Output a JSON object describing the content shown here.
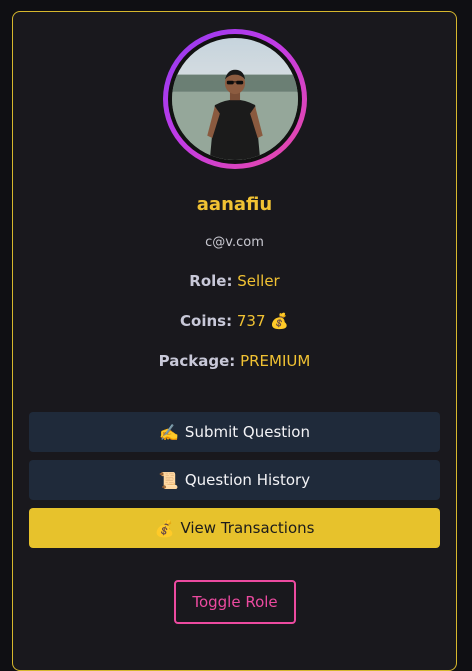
{
  "profile": {
    "username": "aanafiu",
    "email": "c@v.com",
    "role_label": "Role:",
    "role_value": "Seller",
    "coins_label": "Coins:",
    "coins_value": "737",
    "coins_emoji": "💰",
    "package_label": "Package:",
    "package_value": "PREMIUM"
  },
  "actions": {
    "submit": {
      "emoji": "✍️",
      "label": "Submit Question"
    },
    "history": {
      "emoji": "📜",
      "label": "Question History"
    },
    "transactions": {
      "emoji": "💰",
      "label": "View Transactions"
    },
    "toggle_role": "Toggle Role"
  },
  "colors": {
    "accent_yellow": "#f1c233",
    "button_dark": "#1f2a3a",
    "button_yellow": "#e7c22c",
    "toggle_pink": "#ec4aa0",
    "card_border": "#d6b72d"
  },
  "icons": {
    "avatar": "user-avatar-photo"
  }
}
